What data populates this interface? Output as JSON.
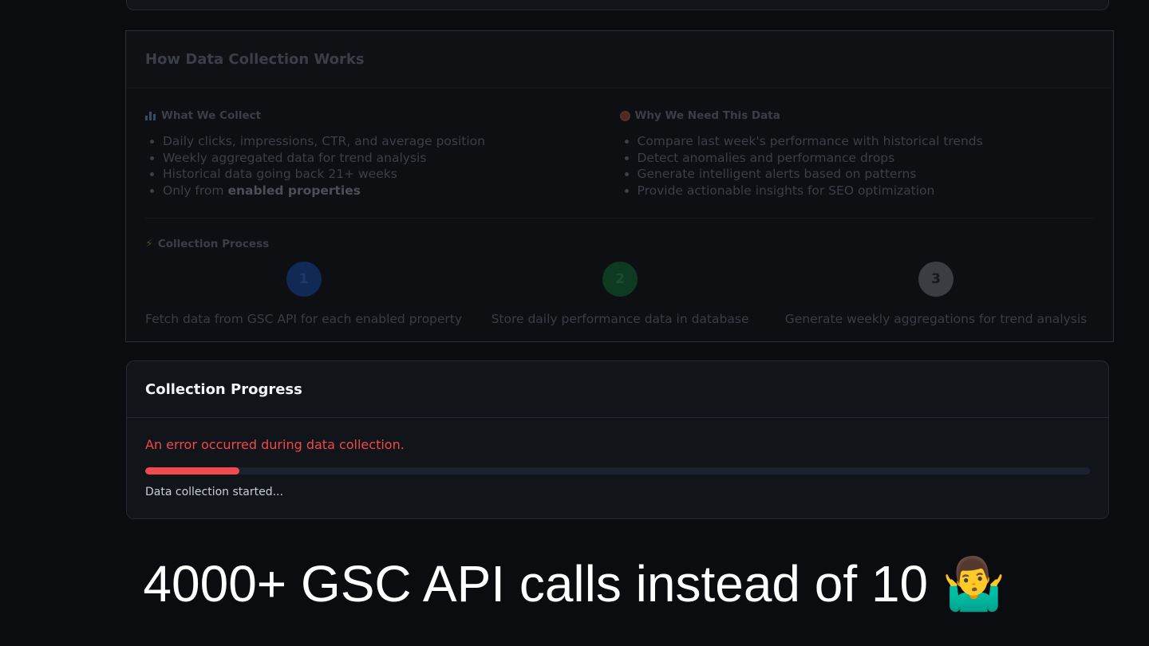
{
  "how_it_works": {
    "title": "How Data Collection Works",
    "what_we_collect": {
      "heading": "What We Collect",
      "icon": "bar-chart-icon",
      "items": [
        "Daily clicks, impressions, CTR, and average position",
        "Weekly aggregated data for trend analysis",
        "Historical data going back 21+ weeks"
      ],
      "last_item_prefix": "Only from",
      "last_item_bold": "enabled properties"
    },
    "why_we_need": {
      "heading": "Why We Need This Data",
      "icon": "target-icon",
      "items": [
        "Compare last week's performance with historical trends",
        "Detect anomalies and performance drops",
        "Generate intelligent alerts based on patterns",
        "Provide actionable insights for SEO optimization"
      ]
    },
    "process": {
      "heading": "Collection Process",
      "icon": "lightning-icon",
      "steps": [
        {
          "number": "1",
          "text": "Fetch data from GSC API for each enabled property",
          "color": "#102a55",
          "text_color": "#1e3a6b"
        },
        {
          "number": "2",
          "text": "Store daily performance data in database",
          "color": "#0f3a22",
          "text_color": "#1d4d2e"
        },
        {
          "number": "3",
          "text": "Generate weekly aggregations for trend analysis",
          "color": "#3a3d42",
          "text_color": "#16181c"
        }
      ]
    }
  },
  "progress": {
    "title": "Collection Progress",
    "error": "An error occurred during data collection.",
    "percent": 10,
    "status": "Data collection started..."
  },
  "caption": {
    "text": "4000+ GSC API calls instead of 10",
    "emoji": "🤷‍♂️"
  }
}
